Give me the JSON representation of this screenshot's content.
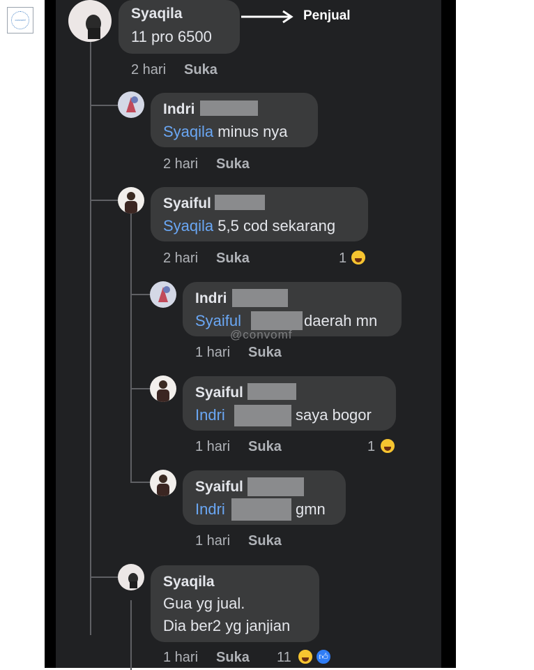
{
  "logo_text": "convomf",
  "annotation": "Penjual",
  "watermark": "@convomf",
  "like_label": "Suka",
  "comments": [
    {
      "name": "Syaqila",
      "lines": [
        "11 pro 6500"
      ],
      "time": "2 hari"
    },
    {
      "name": "Indri",
      "mention": "Syaqila",
      "text": " minus nya",
      "time": "2 hari"
    },
    {
      "name": "Syaiful",
      "mention": "Syaqila",
      "text": " 5,5 cod sekarang",
      "time": "2 hari",
      "reactions": "1"
    },
    {
      "name": "Indri",
      "mention": "Syaiful",
      "text": "daerah mn",
      "time": "1 hari"
    },
    {
      "name": "Syaiful",
      "mention": "Indri",
      "text": "saya bogor",
      "time": "1 hari",
      "reactions": "1"
    },
    {
      "name": "Syaiful",
      "mention": "Indri",
      "text": "gmn",
      "time": "1 hari"
    },
    {
      "name": "Syaqila",
      "lines": [
        "Gua yg jual.",
        "Dia ber2 yg janjian"
      ],
      "time": "1 hari",
      "reactions": "11"
    }
  ],
  "colors": {
    "panel": "#202123",
    "bubble": "#3a3b3c",
    "mention": "#6aa7f4",
    "meta": "#b0b3b8"
  }
}
